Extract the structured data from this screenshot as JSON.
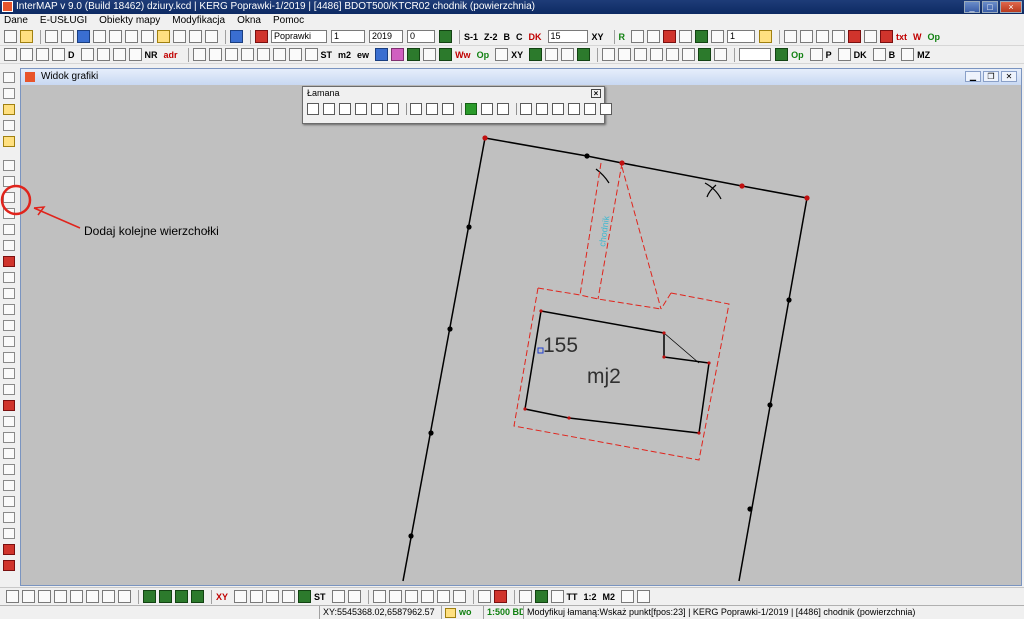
{
  "window": {
    "title": "InterMAP v 9.0 (Build 18462)   dziury.kcd | KERG Poprawki-1/2019 | [4486] BDOT500/KTCR02 chodnik (powierzchnia)",
    "min_label": "_",
    "max_label": "□",
    "close_label": "×"
  },
  "menu": [
    "Dane",
    "E-USŁUGI",
    "Obiekty mapy",
    "Modyfikacja",
    "Okna",
    "Pomoc"
  ],
  "toolbar1": {
    "kerg_value": "Poprawki",
    "number_value": "1",
    "year_value": "2019",
    "zero_value": "0",
    "labels": [
      "S-1",
      "Z-2",
      "B",
      "C",
      "DK"
    ],
    "size_value": "15",
    "xy_label": "XY",
    "r_label": "R",
    "count_value": "1",
    "txt_label": "txt",
    "w_label": "W",
    "op_label": "Op"
  },
  "toolbar2": {
    "nr_label": "NR",
    "adr_label": "adr",
    "d_label": "D",
    "st_label": "ST",
    "m2_label": "m2",
    "ew_label": "ew",
    "ww_label": "Ww",
    "op_label": "Op",
    "xy_label": "XY",
    "op2_label": "Op",
    "p_label": "P",
    "dk_label": "DK",
    "b_label": "B",
    "mz_label": "MZ"
  },
  "graphics_window": {
    "title": "Widok grafiki"
  },
  "palette": {
    "title": "Łamana",
    "close": "×"
  },
  "annotation": {
    "text": "Dodaj kolejne wierzchołki",
    "color": "#e0241c"
  },
  "map": {
    "label_number": "155",
    "label_name": "mj2",
    "label_rotated": "chodnik",
    "outline_color": "#000000",
    "dashed_color": "#e0241c",
    "vertex_color": "#c01010"
  },
  "bottom_toolbar": {
    "labels": [
      "XY",
      "ST",
      "TT",
      "1:2",
      "M2"
    ]
  },
  "status": {
    "coords": "XY:5545368.02,6587962.57",
    "mode": "wo",
    "scale": "1:500 BD",
    "message": "Modyfikuj łamaną:Wskaż punkt[fpos:23] | KERG Poprawki-1/2019 | [4486] chodnik (powierzchnia)"
  }
}
